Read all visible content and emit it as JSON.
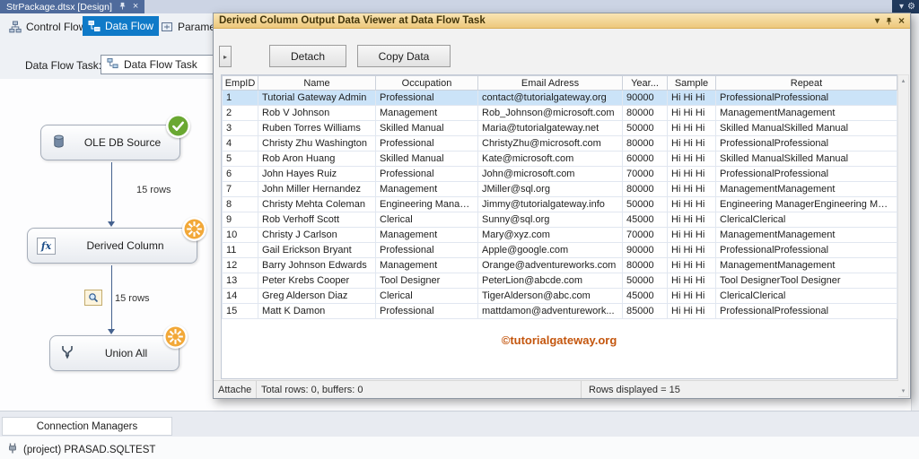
{
  "icons": {
    "chevron_down": "▾",
    "gear": "⚙",
    "close": "×",
    "expand": "▸",
    "scroll_up": "▴",
    "scroll_down": "▾"
  },
  "accent_colors": {
    "active_tab_blue": "#0f7ac8",
    "viewer_title_gold": "#f0cf8e",
    "selected_row_blue": "#cbe3f8",
    "watermark_orange": "#c4560e",
    "success_green": "#6aa832",
    "progress_orange": "#f2a838"
  },
  "ide": {
    "document_tab": "StrPackage.dtsx [Design]",
    "view_tabs": [
      {
        "label": "Control Flow",
        "active": false
      },
      {
        "label": "Data Flow",
        "active": true
      },
      {
        "label": "Paramete",
        "active": false
      }
    ],
    "data_flow_task": {
      "label": "Data Flow Task:",
      "value": "Data Flow Task"
    }
  },
  "designer": {
    "nodes": [
      {
        "label": "OLE DB Source",
        "status": "success"
      },
      {
        "label": "Derived Column",
        "status": "in-progress"
      },
      {
        "label": "Union All",
        "status": "in-progress"
      }
    ],
    "edges": [
      {
        "label": "15 rows",
        "has_viewer": false
      },
      {
        "label": "15 rows",
        "has_viewer": true
      }
    ]
  },
  "viewer": {
    "title": "Derived Column Output Data Viewer at Data Flow Task",
    "toolbar": {
      "detach": "Detach",
      "copy_data": "Copy Data"
    },
    "grid": {
      "columns": [
        "EmpID",
        "Name",
        "Occupation",
        "Email Adress",
        "Year...",
        "Sample",
        "Repeat"
      ],
      "selected_row_index": 0,
      "rows": [
        [
          "1",
          "Tutorial Gateway Admin",
          "Professional",
          "contact@tutorialgateway.org",
          "90000",
          "Hi Hi Hi",
          "ProfessionalProfessional"
        ],
        [
          "2",
          "Rob V Johnson",
          "Management",
          "Rob_Johnson@microsoft.com",
          "80000",
          "Hi Hi Hi",
          "ManagementManagement"
        ],
        [
          "3",
          "Ruben Torres Williams",
          "Skilled Manual",
          "Maria@tutorialgateway.net",
          "50000",
          "Hi Hi Hi",
          "Skilled ManualSkilled Manual"
        ],
        [
          "4",
          "Christy Zhu Washington",
          "Professional",
          "ChristyZhu@microsoft.com",
          "80000",
          "Hi Hi Hi",
          "ProfessionalProfessional"
        ],
        [
          "5",
          "Rob Aron Huang",
          "Skilled Manual",
          "Kate@microsoft.com",
          "60000",
          "Hi Hi Hi",
          "Skilled ManualSkilled Manual"
        ],
        [
          "6",
          "John Hayes Ruiz",
          "Professional",
          "John@microsoft.com",
          "70000",
          "Hi Hi Hi",
          "ProfessionalProfessional"
        ],
        [
          "7",
          "John Miller Hernandez",
          "Management",
          "JMiller@sql.org",
          "80000",
          "Hi Hi Hi",
          "ManagementManagement"
        ],
        [
          "8",
          "Christy Mehta Coleman",
          "Engineering Manager",
          "Jimmy@tutorialgateway.info",
          "50000",
          "Hi Hi Hi",
          "Engineering ManagerEngineering Man..."
        ],
        [
          "9",
          "Rob Verhoff Scott",
          "Clerical",
          "Sunny@sql.org",
          "45000",
          "Hi Hi Hi",
          "ClericalClerical"
        ],
        [
          "10",
          "Christy J Carlson",
          "Management",
          "Mary@xyz.com",
          "70000",
          "Hi Hi Hi",
          "ManagementManagement"
        ],
        [
          "11",
          "Gail Erickson Bryant",
          "Professional",
          "Apple@google.com",
          "90000",
          "Hi Hi Hi",
          "ProfessionalProfessional"
        ],
        [
          "12",
          "Barry Johnson Edwards",
          "Management",
          "Orange@adventureworks.com",
          "80000",
          "Hi Hi Hi",
          "ManagementManagement"
        ],
        [
          "13",
          "Peter Krebs Cooper",
          "Tool Designer",
          "PeterLion@abcde.com",
          "50000",
          "Hi Hi Hi",
          "Tool DesignerTool Designer"
        ],
        [
          "14",
          "Greg Alderson Diaz",
          "Clerical",
          "TigerAlderson@abc.com",
          "45000",
          "Hi Hi Hi",
          "ClericalClerical"
        ],
        [
          "15",
          "Matt K Damon",
          "Professional",
          "mattdamon@adventurework...",
          "85000",
          "Hi Hi Hi",
          "ProfessionalProfessional"
        ]
      ]
    },
    "watermark": "©tutorialgateway.org",
    "status_bar": {
      "pane1": "Attache",
      "pane2": "Total rows: 0, buffers: 0",
      "pane3": "Rows displayed = 15"
    }
  },
  "connection_managers": {
    "title": "Connection Managers",
    "items": [
      {
        "label": "(project) PRASAD.SQLTEST"
      }
    ]
  }
}
